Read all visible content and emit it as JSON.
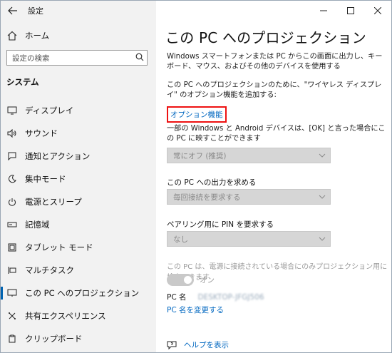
{
  "window": {
    "title": "設定"
  },
  "sidebar": {
    "home_label": "ホーム",
    "search_placeholder": "設定の検索",
    "section_header": "システム",
    "items": [
      {
        "label": "ディスプレイ",
        "icon": "monitor-icon"
      },
      {
        "label": "サウンド",
        "icon": "speaker-icon"
      },
      {
        "label": "通知とアクション",
        "icon": "notification-icon"
      },
      {
        "label": "集中モード",
        "icon": "moon-icon"
      },
      {
        "label": "電源とスリープ",
        "icon": "power-icon"
      },
      {
        "label": "記憶域",
        "icon": "storage-icon"
      },
      {
        "label": "タブレット モード",
        "icon": "tablet-icon"
      },
      {
        "label": "マルチタスク",
        "icon": "multitask-icon"
      },
      {
        "label": "この PC へのプロジェクション",
        "icon": "projection-icon",
        "selected": true
      },
      {
        "label": "共有エクスペリエンス",
        "icon": "share-icon"
      },
      {
        "label": "クリップボード",
        "icon": "clipboard-icon"
      }
    ]
  },
  "main": {
    "title": "この PC へのプロジェクション",
    "intro": "Windows スマートフォンまたは PC からこの画面に出力し、キーボード、マウス、およびその他のデバイスを使用する",
    "optional_note": "この PC へのプロジェクションのために、\"ワイヤレス ディスプレイ\" のオプション機能を追加する:",
    "optional_link": "オプション機能",
    "setting1_label": "一部の Windows と Android デバイスは、[OK] と言った場合にこの PC に映すことができます",
    "setting1_value": "常にオフ (推奨)",
    "setting2_label": "この PC への出力を求める",
    "setting2_value": "毎回接続を要求する",
    "setting3_label": "ペアリング用に PIN を要求する",
    "setting3_value": "なし",
    "power_note": "この PC は、電源に接続されている場合にのみプロジェクション用に検出できます",
    "toggle_label": "オン",
    "pc_name_label": "PC 名",
    "pc_name_value": "DESKTOP-JFGJ506",
    "rename_link": "PC 名を変更する",
    "help_link": "ヘルプを表示"
  }
}
